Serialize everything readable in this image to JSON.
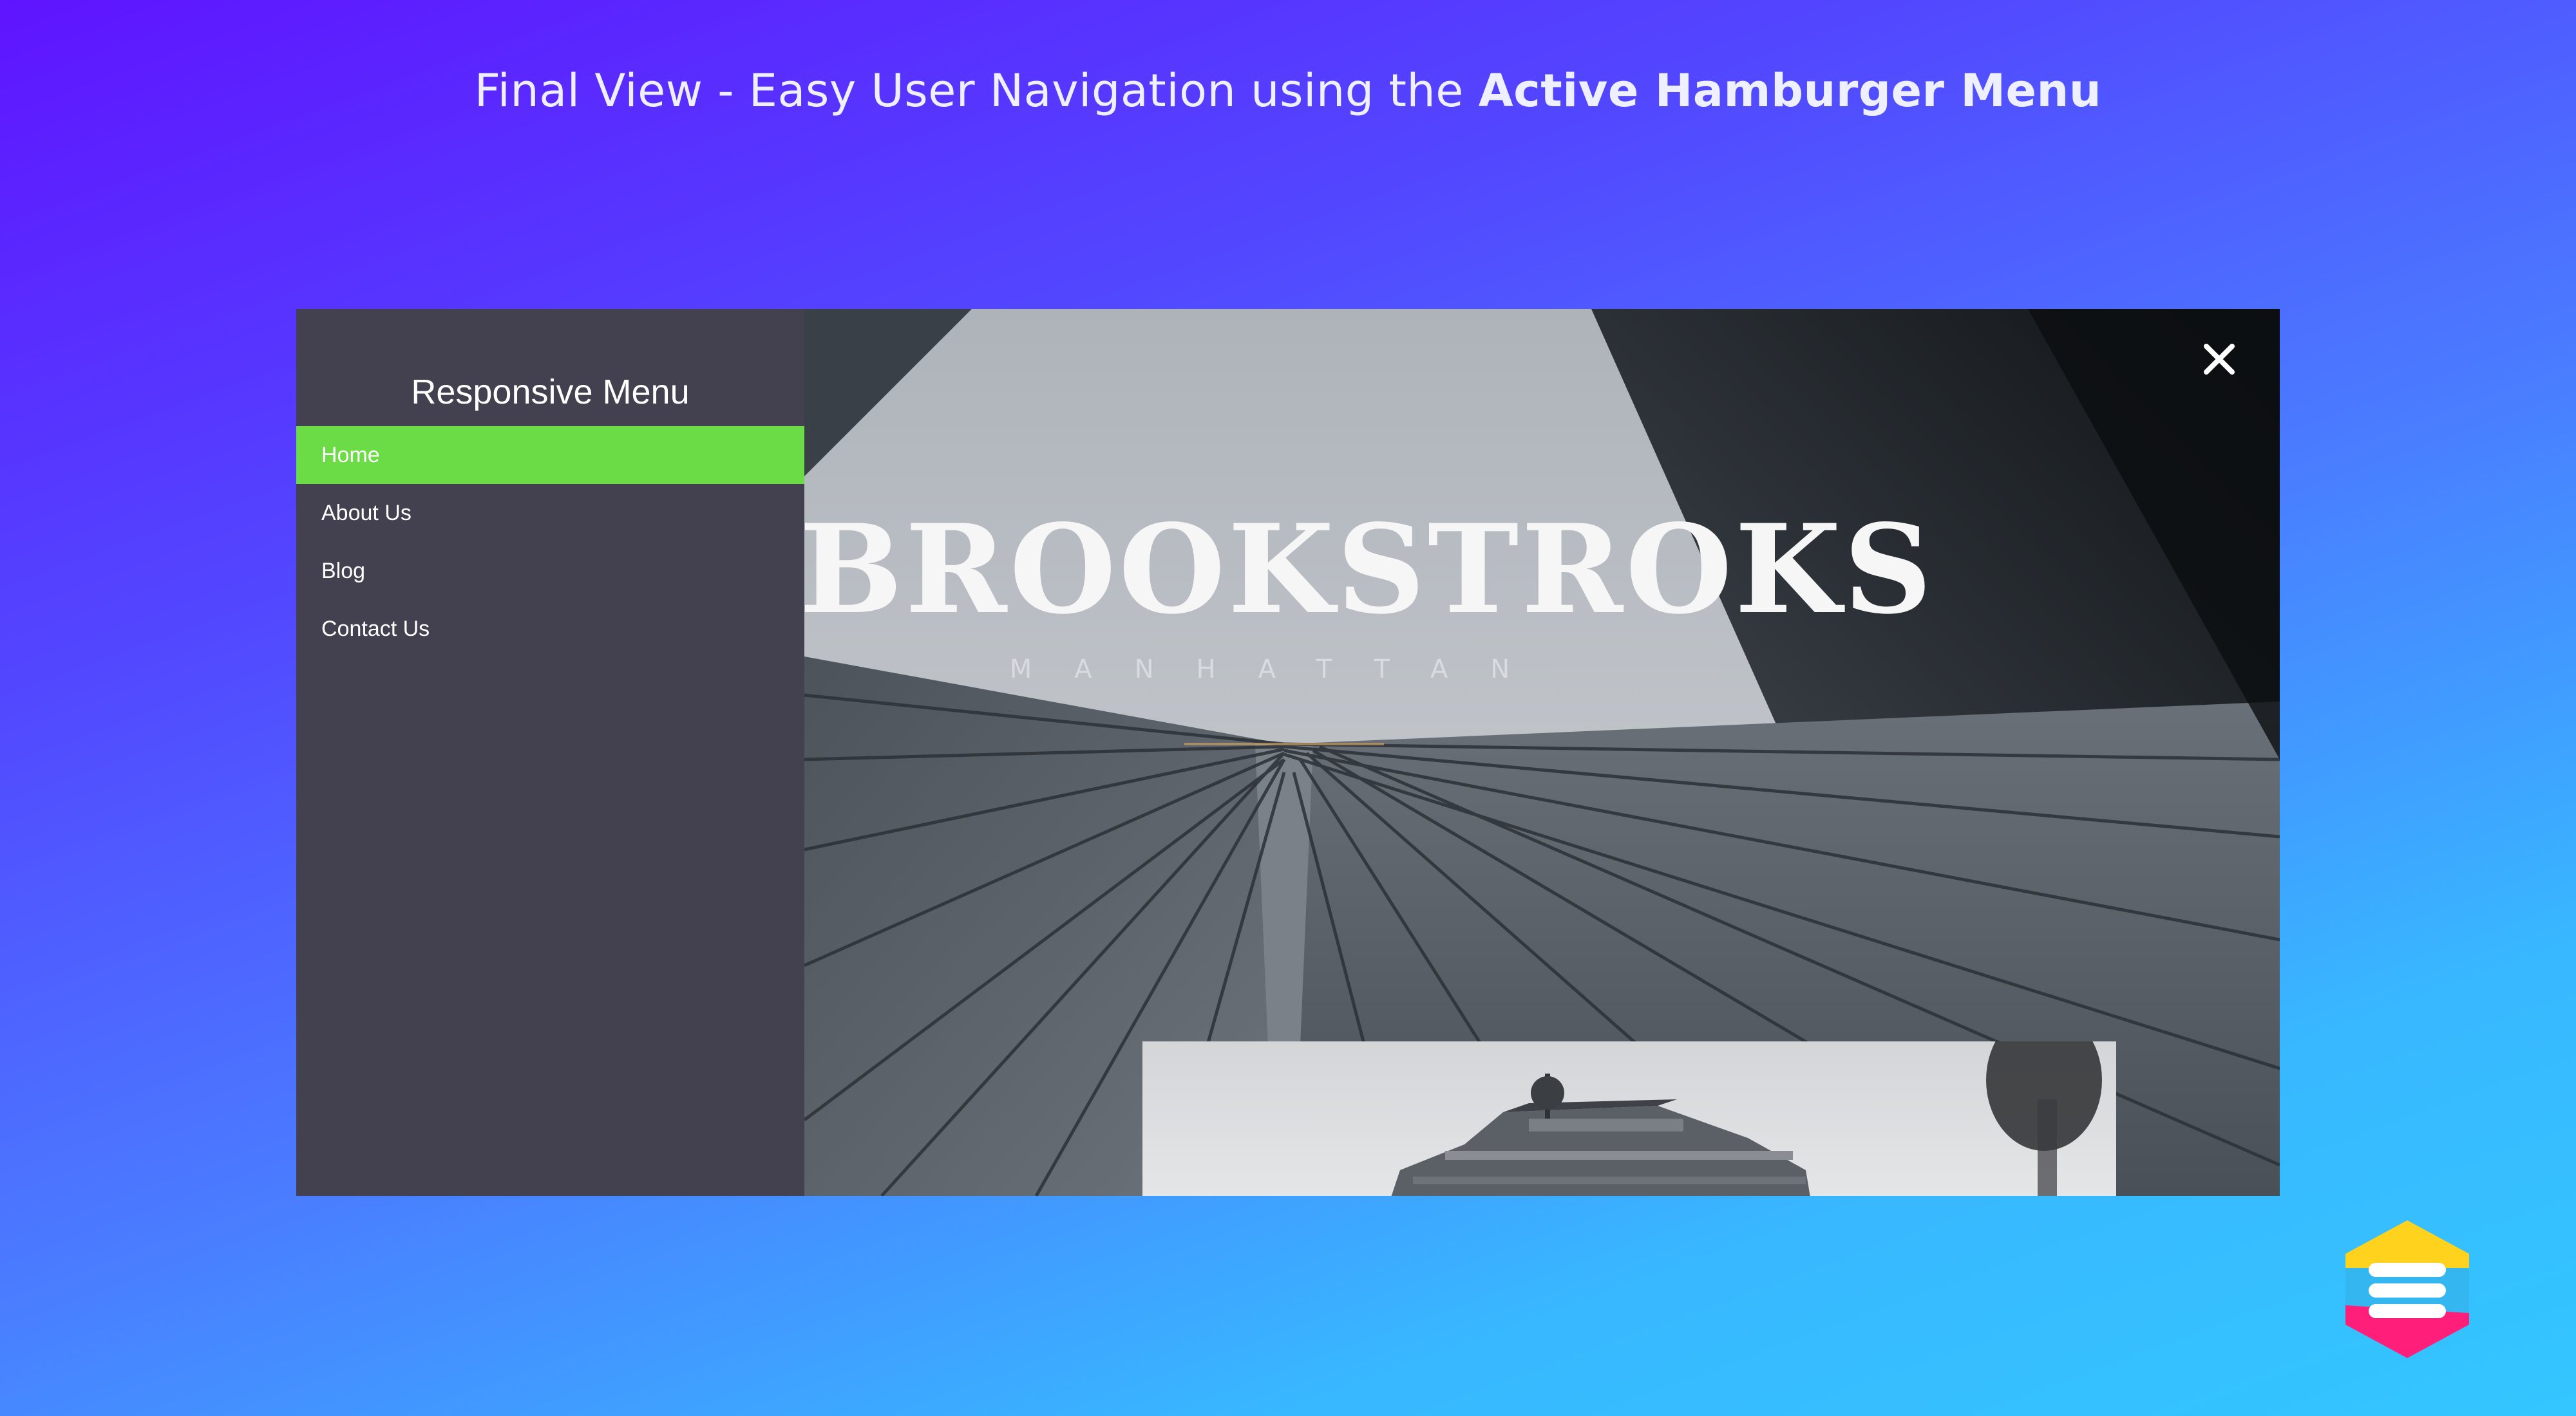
{
  "headline": {
    "prefix": "Final View - Easy User Navigation using the ",
    "emphasis": "Active Hamburger Menu"
  },
  "sidebar": {
    "title": "Responsive Menu",
    "items": [
      {
        "label": "Home",
        "active": true
      },
      {
        "label": "About Us",
        "active": false
      },
      {
        "label": "Blog",
        "active": false
      },
      {
        "label": "Contact Us",
        "active": false
      }
    ]
  },
  "hero": {
    "brand": "BROOKSTROKS",
    "tagline": "MANHATTAN",
    "close_icon": "close-icon"
  },
  "colors": {
    "active_item": "#6cdc46",
    "sidebar_bg": "#43404f",
    "gradient_start": "#5f14ff",
    "gradient_end": "#33c6ff"
  },
  "icons": {
    "badge": "hamburger-menu-logo-icon"
  }
}
